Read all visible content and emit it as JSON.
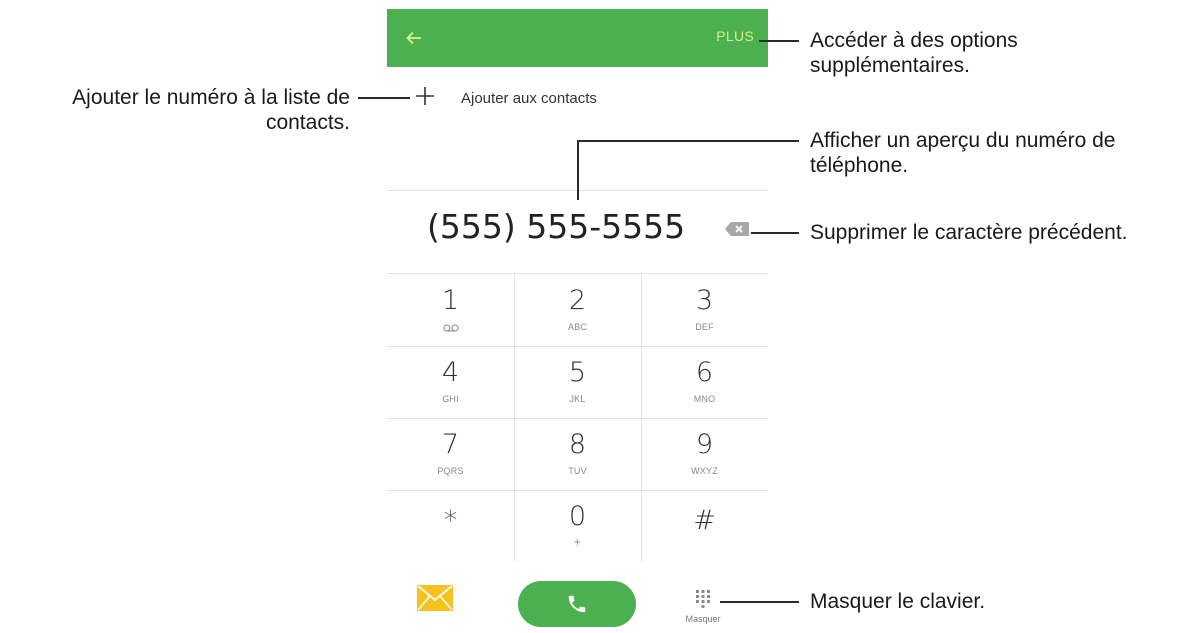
{
  "header": {
    "back_icon": "arrow-left-icon",
    "more_label": "PLUS"
  },
  "add_contact": {
    "icon": "plus-icon",
    "label": "Ajouter aux contacts"
  },
  "display": {
    "number": "(555) 555-5555",
    "backspace_icon": "backspace-icon"
  },
  "keypad": [
    {
      "digit": "1",
      "letters": "",
      "sub_icon": "voicemail-icon"
    },
    {
      "digit": "2",
      "letters": "ABC"
    },
    {
      "digit": "3",
      "letters": "DEF"
    },
    {
      "digit": "4",
      "letters": "GHI"
    },
    {
      "digit": "5",
      "letters": "JKL"
    },
    {
      "digit": "6",
      "letters": "MNO"
    },
    {
      "digit": "7",
      "letters": "PQRS"
    },
    {
      "digit": "8",
      "letters": "TUV"
    },
    {
      "digit": "9",
      "letters": "WXYZ"
    },
    {
      "digit": "*",
      "letters": ""
    },
    {
      "digit": "0",
      "letters": "+"
    },
    {
      "digit": "#",
      "letters": ""
    }
  ],
  "bottom_bar": {
    "message_icon": "envelope-icon",
    "call_icon": "phone-icon",
    "hide_icon": "keypad-grid-icon",
    "hide_label": "Masquer"
  },
  "annotations": {
    "more_options": {
      "line1": "Accéder à des options",
      "line2": "supplémentaires."
    },
    "add_contact": {
      "line1": "Ajouter le numéro à la liste de",
      "line2": "contacts."
    },
    "preview": {
      "line1": "Afficher un aperçu du numéro de",
      "line2": "téléphone."
    },
    "delete": {
      "line1": "Supprimer le caractère précédent."
    },
    "hide_keypad": {
      "line1": "Masquer le clavier."
    }
  },
  "colors": {
    "accent_green": "#4caf50",
    "more_text": "#d9ef8e",
    "message_yellow": "#f7c21f"
  }
}
